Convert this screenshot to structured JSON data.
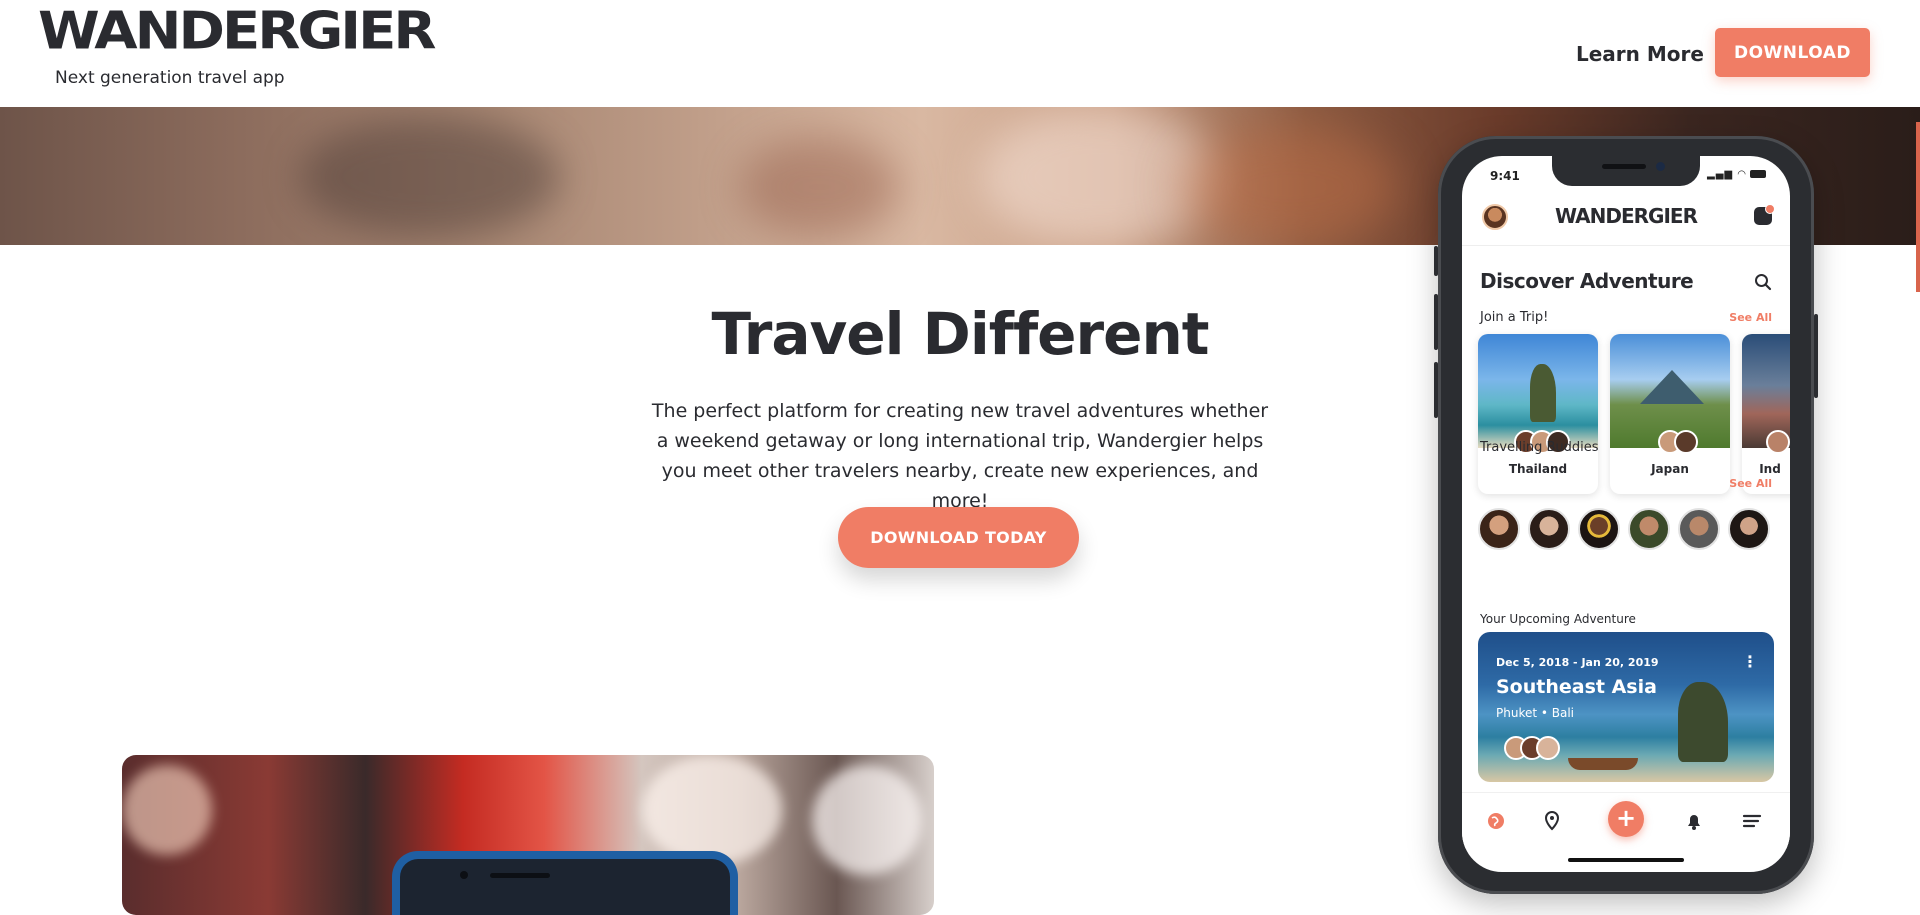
{
  "header": {
    "logo": "WANDERGIER",
    "tagline": "Next generation travel app",
    "learn_more": "Learn More",
    "download": "DOWNLOAD"
  },
  "hero": {
    "title": "Travel Different",
    "description": "The perfect platform for creating new travel adventures whether a weekend getaway or long international trip, Wandergier helps you meet other travelers nearby, create new experiences, and more!",
    "cta": "DOWNLOAD TODAY"
  },
  "phone": {
    "status_time": "9:41",
    "app_logo": "WANDERGIER",
    "section_title": "Discover Adventure",
    "join_label": "Join a Trip!",
    "see_all": "See All",
    "trips": [
      {
        "name": "Thailand"
      },
      {
        "name": "Japan"
      },
      {
        "name": "Ind"
      }
    ],
    "buddies_label": "Travelling Buddies",
    "upcoming_label": "Your Upcoming Adventure",
    "adventure": {
      "dates": "Dec 5, 2018 - Jan 20, 2019",
      "title": "Southeast Asia",
      "places": "Phuket • Bali",
      "more": "⋮"
    },
    "tabs": {
      "add": "+"
    }
  },
  "colors": {
    "accent": "#f07d65",
    "text": "#2a2b30"
  },
  "icons": [
    "search-icon",
    "inbox-icon",
    "globe-icon",
    "map-pin-icon",
    "plus-icon",
    "bell-icon",
    "menu-icon",
    "more-vertical-icon"
  ]
}
